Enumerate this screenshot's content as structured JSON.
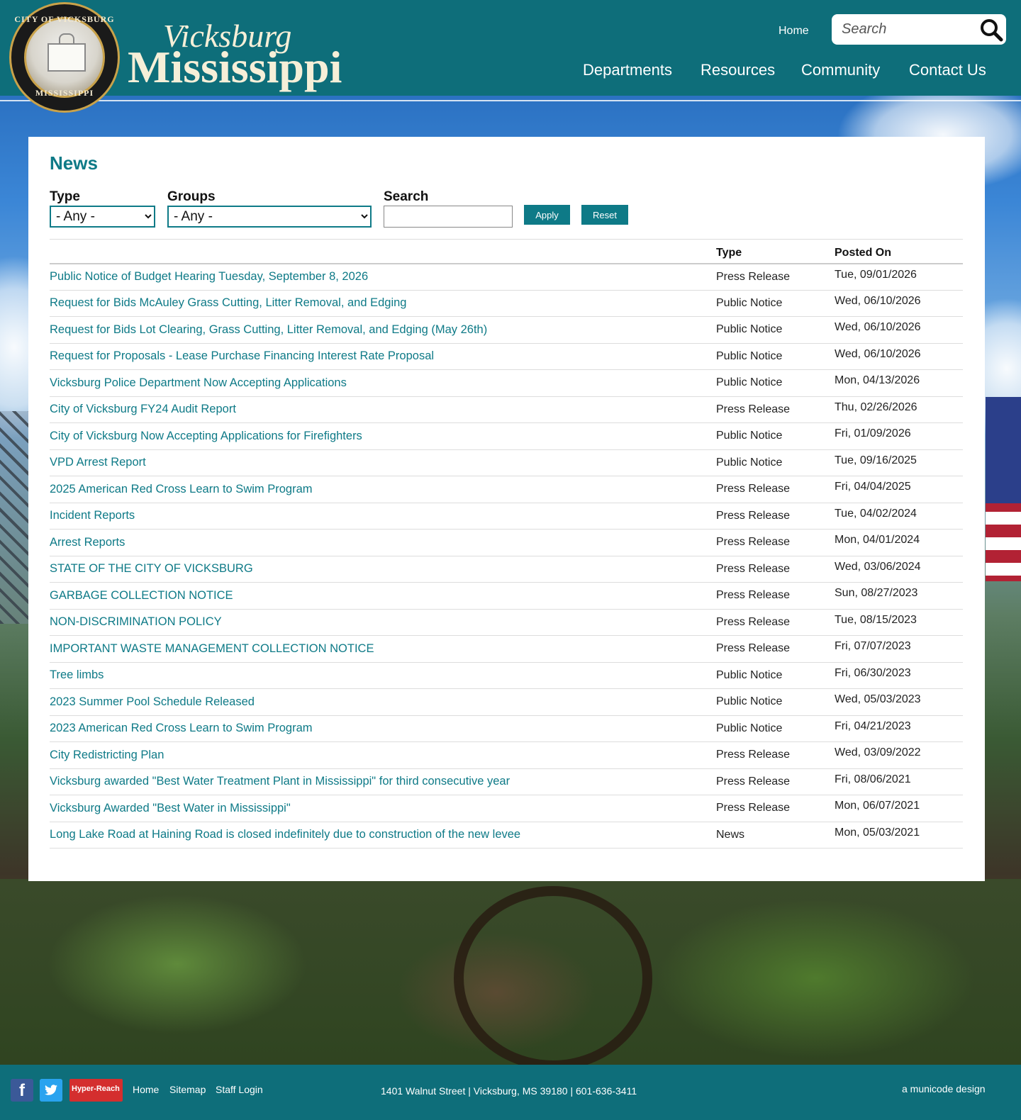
{
  "header": {
    "seal_text_top": "CITY OF VICKSBURG",
    "seal_text_bottom": "MISSISSIPPI",
    "logo_script": "Vicksburg",
    "logo_main": "Mississippi",
    "home_link": "Home",
    "search_placeholder": "Search",
    "nav": [
      "Departments",
      "Resources",
      "Community",
      "Contact Us"
    ]
  },
  "main": {
    "title": "News",
    "filters": {
      "type_label": "Type",
      "type_value": "- Any -",
      "groups_label": "Groups",
      "groups_value": "- Any -",
      "search_label": "Search",
      "search_value": "",
      "apply_label": "Apply",
      "reset_label": "Reset"
    },
    "table": {
      "headers": [
        "",
        "Type",
        "Posted On"
      ],
      "rows": [
        {
          "title": "Public Notice of Budget Hearing Tuesday, September 8, 2026",
          "type": "Press Release",
          "posted": "Tue, 09/01/2026"
        },
        {
          "title": "Request for Bids McAuley Grass Cutting, Litter Removal, and Edging",
          "type": "Public Notice",
          "posted": "Wed, 06/10/2026"
        },
        {
          "title": "Request for Bids Lot Clearing, Grass Cutting, Litter Removal, and Edging (May 26th)",
          "type": "Public Notice",
          "posted": "Wed, 06/10/2026"
        },
        {
          "title": "Request for Proposals - Lease Purchase Financing Interest Rate Proposal",
          "type": "Public Notice",
          "posted": "Wed, 06/10/2026"
        },
        {
          "title": "Vicksburg Police Department Now Accepting Applications",
          "type": "Public Notice",
          "posted": "Mon, 04/13/2026"
        },
        {
          "title": "City of Vicksburg FY24 Audit Report",
          "type": "Press Release",
          "posted": "Thu, 02/26/2026"
        },
        {
          "title": "City of Vicksburg Now Accepting Applications for Firefighters",
          "type": "Public Notice",
          "posted": "Fri, 01/09/2026"
        },
        {
          "title": "VPD Arrest Report",
          "type": "Public Notice",
          "posted": "Tue, 09/16/2025"
        },
        {
          "title": "2025 American Red Cross Learn to Swim Program",
          "type": "Press Release",
          "posted": "Fri, 04/04/2025"
        },
        {
          "title": "Incident Reports",
          "type": "Press Release",
          "posted": "Tue, 04/02/2024"
        },
        {
          "title": "Arrest Reports",
          "type": "Press Release",
          "posted": "Mon, 04/01/2024"
        },
        {
          "title": "STATE OF THE CITY OF VICKSBURG",
          "type": "Press Release",
          "posted": "Wed, 03/06/2024"
        },
        {
          "title": "GARBAGE COLLECTION NOTICE",
          "type": "Press Release",
          "posted": "Sun, 08/27/2023"
        },
        {
          "title": "NON-DISCRIMINATION POLICY",
          "type": "Press Release",
          "posted": "Tue, 08/15/2023"
        },
        {
          "title": "IMPORTANT WASTE MANAGEMENT COLLECTION NOTICE",
          "type": "Press Release",
          "posted": "Fri, 07/07/2023"
        },
        {
          "title": "Tree limbs",
          "type": "Public Notice",
          "posted": "Fri, 06/30/2023"
        },
        {
          "title": "2023 Summer Pool Schedule Released",
          "type": "Public Notice",
          "posted": "Wed, 05/03/2023"
        },
        {
          "title": "2023 American Red Cross Learn to Swim Program",
          "type": "Public Notice",
          "posted": "Fri, 04/21/2023"
        },
        {
          "title": "City Redistricting Plan",
          "type": "Press Release",
          "posted": "Wed, 03/09/2022"
        },
        {
          "title": "Vicksburg awarded \"Best Water Treatment Plant in Mississippi\" for third consecutive year",
          "type": "Press Release",
          "posted": "Fri, 08/06/2021"
        },
        {
          "title": "Vicksburg Awarded \"Best Water in Mississippi\"",
          "type": "Press Release",
          "posted": "Mon, 06/07/2021"
        },
        {
          "title": "Long Lake Road at Haining Road is closed indefinitely due to construction of the new levee",
          "type": "News",
          "posted": "Mon, 05/03/2021"
        }
      ]
    }
  },
  "footer": {
    "facebook_icon": "facebook-icon",
    "twitter_icon": "twitter-icon",
    "hyperreach_label": "Hyper-Reach",
    "links": [
      "Home",
      "Sitemap",
      "Staff Login"
    ],
    "address": "1401 Walnut Street | Vicksburg, MS 39180 | 601-636-3411",
    "credit": "a municode design"
  },
  "colors": {
    "brand_teal": "#0e6e7a",
    "link_teal": "#0e7a87",
    "logo_cream": "#f6efd8",
    "seal_gold": "#c9a24a"
  }
}
